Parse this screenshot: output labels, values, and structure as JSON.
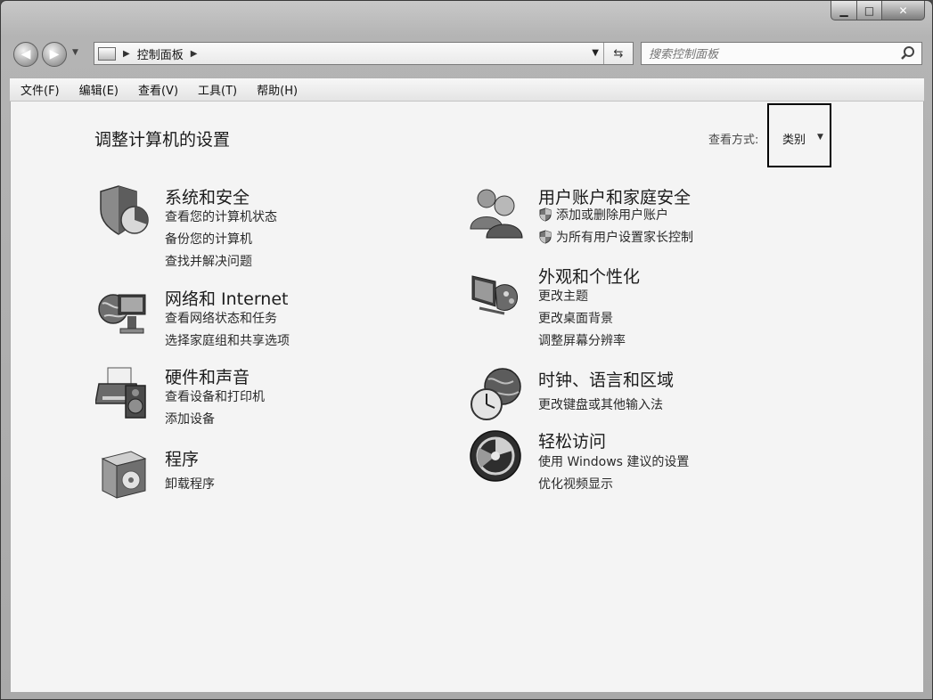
{
  "nav": {
    "breadcrumb": "控制面板",
    "search_placeholder": "搜索控制面板"
  },
  "menu": [
    {
      "label": "文件(F)"
    },
    {
      "label": "编辑(E)"
    },
    {
      "label": "查看(V)"
    },
    {
      "label": "工具(T)"
    },
    {
      "label": "帮助(H)"
    }
  ],
  "content": {
    "title": "调整计算机的设置",
    "view_by_label": "查看方式:",
    "view_by_value": "类别"
  },
  "categories": {
    "system": {
      "title": "系统和安全",
      "icon": "shield-chart-icon",
      "links": [
        "查看您的计算机状态",
        "备份您的计算机",
        "查找并解决问题"
      ]
    },
    "network": {
      "title": "网络和 Internet",
      "icon": "globe-network-icon",
      "links": [
        "查看网络状态和任务",
        "选择家庭组和共享选项"
      ]
    },
    "hardware": {
      "title": "硬件和声音",
      "icon": "printer-speaker-icon",
      "links": [
        "查看设备和打印机",
        "添加设备"
      ]
    },
    "programs": {
      "title": "程序",
      "icon": "programs-box-icon",
      "links": [
        "卸载程序"
      ]
    },
    "users": {
      "title": "用户账户和家庭安全",
      "icon": "users-icon",
      "links": [
        "添加或删除用户账户",
        "为所有用户设置家长控制"
      ]
    },
    "appearance": {
      "title": "外观和个性化",
      "icon": "monitor-palette-icon",
      "links": [
        "更改主题",
        "更改桌面背景",
        "调整屏幕分辨率"
      ]
    },
    "clock": {
      "title": "时钟、语言和区域",
      "icon": "clock-globe-icon",
      "links": [
        "更改键盘或其他输入法"
      ]
    },
    "ease": {
      "title": "轻松访问",
      "icon": "ease-of-access-icon",
      "links": [
        "使用 Windows 建议的设置",
        "优化视频显示"
      ]
    }
  }
}
